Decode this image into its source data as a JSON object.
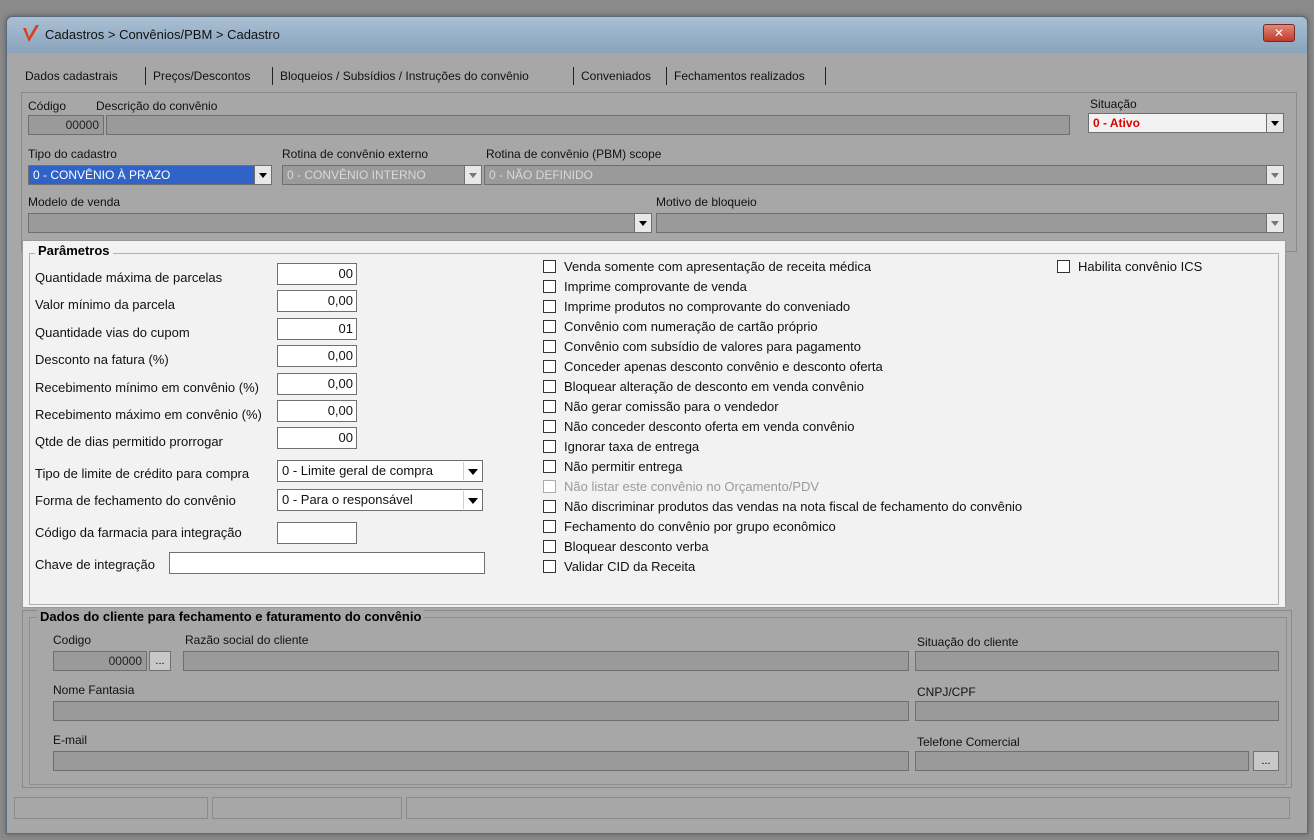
{
  "window": {
    "title": "Cadastros > Convênios/PBM > Cadastro",
    "close_label": "✕",
    "accent_color": "#e03a1e"
  },
  "tabs": [
    {
      "label": "Dados cadastrais"
    },
    {
      "label": "Preços/Descontos"
    },
    {
      "label": "Bloqueios / Subsídios / Instruções do convênio"
    },
    {
      "label": "Conveniados"
    },
    {
      "label": "Fechamentos realizados"
    }
  ],
  "header": {
    "codigo_label": "Código",
    "codigo_value": "00000",
    "descricao_label": "Descrição do convênio",
    "descricao_value": "",
    "situacao_label": "Situação",
    "situacao_value": "0 - Ativo",
    "situacao_color": "#e00000",
    "tipo_label": "Tipo do cadastro",
    "tipo_value": "0 - CONVÊNIO À PRAZO",
    "rotina_externo_label": "Rotina de convênio externo",
    "rotina_externo_value": "0 - CONVÊNIO INTERNO",
    "rotina_pbm_label": "Rotina de convênio (PBM) scope",
    "rotina_pbm_value": "0 - NÃO DEFINIDO",
    "modelo_label": "Modelo de venda",
    "modelo_value": "",
    "motivo_label": "Motivo de bloqueio",
    "motivo_value": ""
  },
  "parametros": {
    "title": "Parâmetros",
    "fields": [
      {
        "label": "Quantidade máxima de parcelas",
        "value": "00"
      },
      {
        "label": "Valor mínimo da parcela",
        "value": "0,00"
      },
      {
        "label": "Quantidade vias do cupom",
        "value": "01"
      },
      {
        "label": "Desconto na fatura (%)",
        "value": "0,00"
      },
      {
        "label": "Recebimento mínimo em convênio (%)",
        "value": "0,00"
      },
      {
        "label": "Recebimento máximo em convênio (%)",
        "value": "0,00"
      },
      {
        "label": "Qtde de dias permitido prorrogar",
        "value": "00"
      }
    ],
    "tipo_limite_label": "Tipo de limite de crédito para compra",
    "tipo_limite_value": "0 - Limite geral de compra",
    "forma_fechamento_label": "Forma de fechamento do convênio",
    "forma_fechamento_value": "0 - Para o responsável",
    "codigo_farmacia_label": "Código da farmacia para integração",
    "codigo_farmacia_value": "",
    "chave_label": "Chave de integração",
    "chave_value": "",
    "checkboxes": [
      {
        "label": "Venda somente com apresentação de receita médica"
      },
      {
        "label": "Imprime comprovante de venda"
      },
      {
        "label": "Imprime produtos no comprovante do conveniado"
      },
      {
        "label": "Convênio com numeração de cartão próprio"
      },
      {
        "label": "Convênio com subsídio de valores para pagamento"
      },
      {
        "label": "Conceder apenas desconto convênio e desconto oferta"
      },
      {
        "label": "Bloquear alteração de desconto em venda convênio"
      },
      {
        "label": "Não gerar comissão para o vendedor"
      },
      {
        "label": "Não conceder desconto oferta em venda convênio"
      },
      {
        "label": "Ignorar taxa de entrega"
      },
      {
        "label": "Não permitir entrega"
      },
      {
        "label": "Não listar este convênio no Orçamento/PDV"
      },
      {
        "label": "Não discriminar produtos das vendas na nota fiscal de fechamento do convênio"
      },
      {
        "label": "Fechamento do convênio por grupo econômico"
      },
      {
        "label": "Bloquear desconto verba"
      },
      {
        "label": "Validar CID da Receita"
      }
    ],
    "ics_label": "Habilita convênio ICS"
  },
  "cliente": {
    "title": "Dados do cliente para fechamento e faturamento do convênio",
    "codigo_label": "Codigo",
    "codigo_value": "00000",
    "lookup_label": "...",
    "razao_label": "Razão social do cliente",
    "razao_value": "",
    "situacao_label": "Situação do cliente",
    "situacao_value": "",
    "nome_label": "Nome Fantasia",
    "nome_value": "",
    "cnpj_label": "CNPJ/CPF",
    "cnpj_value": "",
    "email_label": "E-mail",
    "email_value": "",
    "telefone_label": "Telefone Comercial",
    "telefone_value": "",
    "telefone_btn": "..."
  }
}
